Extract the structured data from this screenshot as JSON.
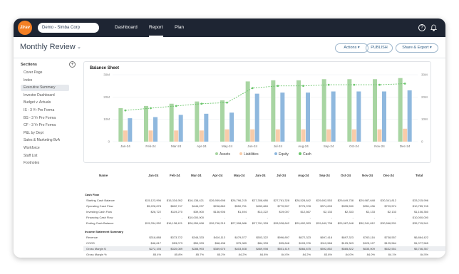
{
  "app": {
    "logo_text": "Jirav",
    "company": "Demo - Simba Corp"
  },
  "nav": {
    "dashboard": "Dashboard",
    "report": "Report",
    "plan": "Plan"
  },
  "icons": {
    "help": "help-circle-icon",
    "bell": "bell-icon"
  },
  "header": {
    "title": "Monthly Review",
    "actions": "Actions",
    "publish": "PUBLISH",
    "share": "Share & Export"
  },
  "sidebar": {
    "title": "Sections",
    "items": [
      "Cover Page",
      "Index",
      "Executive Summary",
      "Investor Dashboard",
      "Budget v. Actuals",
      "IS - 3 Yr Pro Forma",
      "BS - 3 Yr Pro Forma",
      "CF - 3 Yr Pro Forma",
      "P&L by Dept",
      "Sales & Marketing BvA",
      "Workforce",
      "Staff List",
      "Footnotes"
    ],
    "active_index": 2
  },
  "chart_data": {
    "type": "bar",
    "title": "Balance Sheet",
    "categories": [
      "Jan-24",
      "Feb-24",
      "Mar-24",
      "Apr-24",
      "May-24",
      "Jun-24",
      "Jul-24",
      "Aug-24",
      "Sep-24",
      "Oct-24",
      "Nov-24",
      "Dec-24"
    ],
    "y_ticks": [
      "0",
      "10M",
      "20M",
      "30M"
    ],
    "ylim": [
      0,
      30
    ],
    "series": [
      {
        "name": "Assets",
        "values": [
          15,
          16,
          17,
          18,
          18.5,
          27,
          27.5,
          27.5,
          28,
          28,
          28,
          28.5
        ],
        "color": "#a8d5a2"
      },
      {
        "name": "Liabilities",
        "values": [
          5,
          5,
          5,
          5,
          5.5,
          5.5,
          5.5,
          5.5,
          5.5,
          5.5,
          5.5,
          5.8
        ],
        "color": "#f8ccaa"
      },
      {
        "name": "Equity",
        "values": [
          10.5,
          11,
          12,
          12.5,
          13,
          21.5,
          22,
          22,
          22.5,
          22.5,
          22.5,
          23
        ],
        "color": "#8fb8de"
      },
      {
        "name": "Cash",
        "type": "line",
        "values": [
          14,
          15,
          16,
          17,
          17.5,
          24,
          25,
          25,
          25.5,
          25.5,
          25.5,
          26
        ],
        "color": "#6cc66c"
      }
    ],
    "grid": true,
    "legend_position": "bottom"
  },
  "table": {
    "columns": [
      "Name",
      "Jan-24",
      "Feb-24",
      "Mar-24",
      "Apr-24",
      "May-24",
      "Jun-24",
      "Jul-24",
      "Aug-24",
      "Sep-24",
      "Oct-24",
      "Nov-24",
      "Dec-24",
      "Total"
    ],
    "rows": [
      {
        "label": "Cash Flow",
        "section": true,
        "values": []
      },
      {
        "label": "Starting Cash Balance",
        "values": [
          "$15,123,996",
          "$15,334,952",
          "$16,138,421",
          "$26,959,698",
          "$26,796,215",
          "$27,308,686",
          "$27,761,328",
          "$28,528,842",
          "$29,692,553",
          "$29,649,738",
          "$29,987,648",
          "$30,341,812",
          "$33,215,996"
        ]
      },
      {
        "label": "Operating Cash Flow",
        "values": [
          "$5,228,678",
          "$802,747",
          "$446,237",
          "$298,863",
          "$550,751",
          "$453,869",
          "$770,597",
          "$776,378",
          "$374,693",
          "$335,530",
          "$351,436",
          "$729,574",
          "$10,755,745"
        ]
      },
      {
        "label": "Investing Cash Flow",
        "values": [
          "$26,722",
          "$119,270",
          "$39,000",
          "$136,906",
          "$1,494",
          "$13,222",
          "$19,007",
          "$12,667",
          "$2,133",
          "$2,333",
          "$2,133",
          "$2,133",
          "$1,106,350"
        ]
      },
      {
        "label": "Financing Cash Flow",
        "values": [
          "-",
          "-",
          "$10,000,000",
          "-",
          "-",
          "-",
          "-",
          "-",
          "-",
          "-",
          "-",
          "-",
          "$10,000,000"
        ]
      },
      {
        "label": "Ending Cash Balance",
        "values": [
          "$15,334,952",
          "$16,138,421",
          "$26,959,698",
          "$26,796,215",
          "$27,308,686",
          "$27,761,328",
          "$28,528,842",
          "$29,692,553",
          "$29,649,738",
          "$29,987,648",
          "$30,341,812",
          "$30,566,531",
          "$35,715,541"
        ]
      },
      {
        "label": "Income Statement Summary",
        "section": true,
        "values": []
      },
      {
        "label": "Revenue",
        "values": [
          "$318,888",
          "$373,722",
          "$348,333",
          "$416,113",
          "$479,577",
          "$503,322",
          "$996,897",
          "$672,323",
          "$697,418",
          "$697,323",
          "$763,116",
          "$738,557",
          "$6,864,422"
        ]
      },
      {
        "label": "COGS",
        "values": [
          "$46,617",
          "$53,073",
          "$59,933",
          "$68,438",
          "$75,989",
          "$84,333",
          "$95,848",
          "$103,976",
          "$119,568",
          "$125,303",
          "$125,127",
          "$125,564",
          "$1,077,565"
        ]
      },
      {
        "label": "Gross Margin $",
        "shaded": true,
        "values": [
          "$272,193",
          "$320,089",
          "$288,993",
          "$389,675",
          "$403,408",
          "$469,098",
          "$501,419",
          "$566,875",
          "$592,852",
          "$585,822",
          "$635,009",
          "$632,551",
          "$5,746,357"
        ]
      },
      {
        "label": "Gross Margin %",
        "values": [
          "85.4%",
          "85.8%",
          "85.7%",
          "85.2%",
          "84.2%",
          "84.8%",
          "84.0%",
          "84.2%",
          "83.8%",
          "84.0%",
          "84.0%",
          "84.1%",
          "84.5%"
        ]
      }
    ]
  }
}
